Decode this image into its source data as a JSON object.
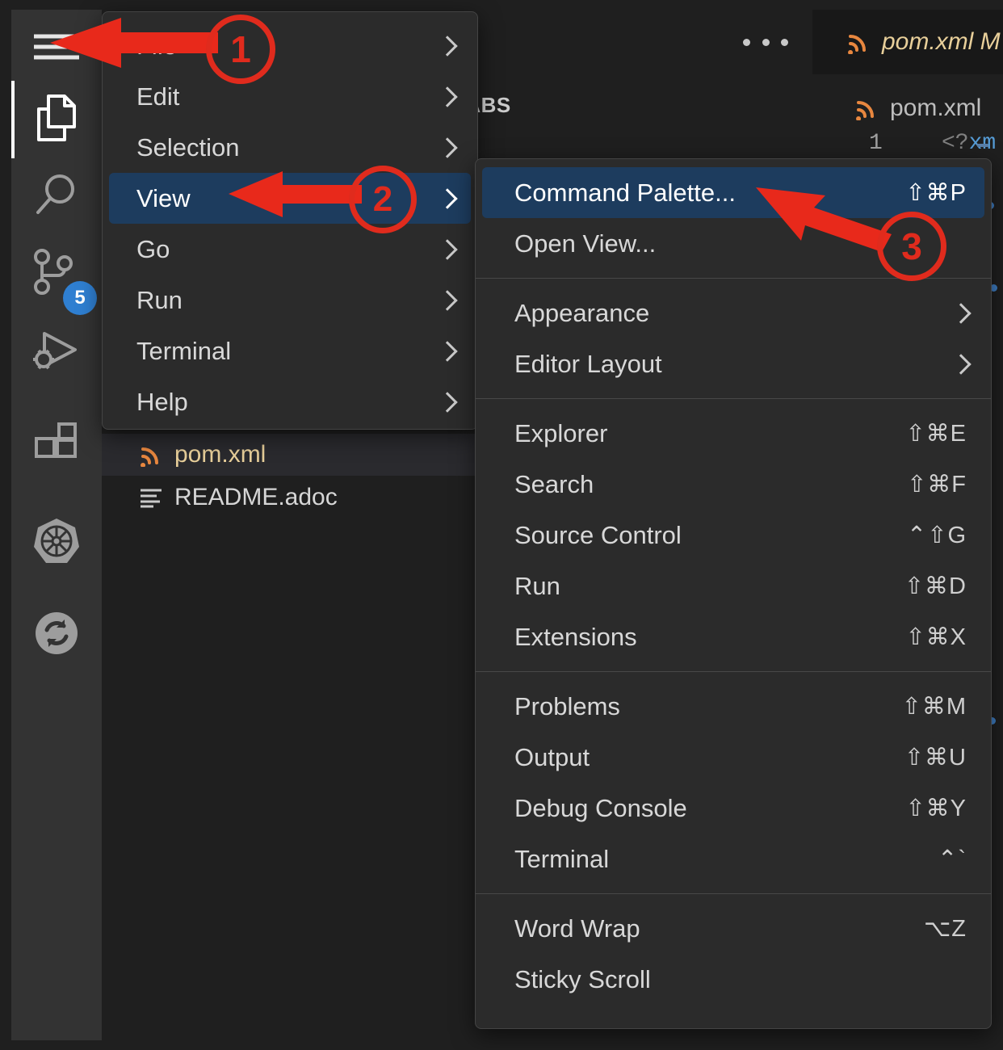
{
  "app": {
    "name": "Visual Studio Code",
    "theme_bg": "#1f1f1f",
    "accent_selected": "#1d3c5e",
    "annotation_color": "#e02b1d"
  },
  "activity_bar": {
    "items": [
      {
        "icon": "hamburger-menu-icon",
        "label": "Menu",
        "active": false,
        "badge": null
      },
      {
        "icon": "files-explorer-icon",
        "label": "Explorer",
        "active": true,
        "badge": null
      },
      {
        "icon": "search-icon",
        "label": "Search",
        "active": false,
        "badge": null
      },
      {
        "icon": "source-control-icon",
        "label": "Source Control",
        "active": false,
        "badge": "5"
      },
      {
        "icon": "run-and-debug-icon",
        "label": "Run and Debug",
        "active": false,
        "badge": null
      },
      {
        "icon": "extensions-icon",
        "label": "Extensions",
        "active": false,
        "badge": null
      },
      {
        "icon": "kubernetes-icon",
        "label": "Kubernetes",
        "active": false,
        "badge": null
      },
      {
        "icon": "sync-refresh-icon",
        "label": "Sync",
        "active": false,
        "badge": null
      }
    ]
  },
  "sidebar": {
    "title": "LABS",
    "more_actions_icon": "ellipsis-icon",
    "files": [
      {
        "name": "pom.xml",
        "icon": "xml-file-icon",
        "selected": true
      },
      {
        "name": "README.adoc",
        "icon": "asciidoc-file-icon",
        "selected": false
      }
    ]
  },
  "editor": {
    "tab": {
      "label": "pom.xml M",
      "icon": "xml-file-icon",
      "modified": true
    },
    "breadcrumb": {
      "label": "pom.xml",
      "icon": "xml-file-icon"
    },
    "line_number": "1",
    "code_fragment": "<?xm",
    "code_colors": {
      "tag_punct": "#808080",
      "tag_name": "#569cd6"
    }
  },
  "main_menu": {
    "items": [
      {
        "label": "File",
        "submenu": true,
        "selected": false
      },
      {
        "label": "Edit",
        "submenu": true,
        "selected": false
      },
      {
        "label": "Selection",
        "submenu": true,
        "selected": false
      },
      {
        "label": "View",
        "submenu": true,
        "selected": true
      },
      {
        "label": "Go",
        "submenu": true,
        "selected": false
      },
      {
        "label": "Run",
        "submenu": true,
        "selected": false
      },
      {
        "label": "Terminal",
        "submenu": true,
        "selected": false
      },
      {
        "label": "Help",
        "submenu": true,
        "selected": false
      }
    ]
  },
  "view_submenu": {
    "groups": [
      {
        "items": [
          {
            "label": "Command Palette...",
            "shortcut": "⇧⌘P",
            "submenu": false,
            "selected": true
          },
          {
            "label": "Open View...",
            "shortcut": "",
            "submenu": false,
            "selected": false
          }
        ]
      },
      {
        "items": [
          {
            "label": "Appearance",
            "shortcut": "",
            "submenu": true,
            "selected": false
          },
          {
            "label": "Editor Layout",
            "shortcut": "",
            "submenu": true,
            "selected": false
          }
        ]
      },
      {
        "items": [
          {
            "label": "Explorer",
            "shortcut": "⇧⌘E",
            "submenu": false,
            "selected": false
          },
          {
            "label": "Search",
            "shortcut": "⇧⌘F",
            "submenu": false,
            "selected": false
          },
          {
            "label": "Source Control",
            "shortcut": "⌃⇧G",
            "submenu": false,
            "selected": false
          },
          {
            "label": "Run",
            "shortcut": "⇧⌘D",
            "submenu": false,
            "selected": false
          },
          {
            "label": "Extensions",
            "shortcut": "⇧⌘X",
            "submenu": false,
            "selected": false
          }
        ]
      },
      {
        "items": [
          {
            "label": "Problems",
            "shortcut": "⇧⌘M",
            "submenu": false,
            "selected": false
          },
          {
            "label": "Output",
            "shortcut": "⇧⌘U",
            "submenu": false,
            "selected": false
          },
          {
            "label": "Debug Console",
            "shortcut": "⇧⌘Y",
            "submenu": false,
            "selected": false
          },
          {
            "label": "Terminal",
            "shortcut": "⌃`",
            "submenu": false,
            "selected": false
          }
        ]
      },
      {
        "items": [
          {
            "label": "Word Wrap",
            "shortcut": "⌥Z",
            "submenu": false,
            "selected": false
          },
          {
            "label": "Sticky Scroll",
            "shortcut": "",
            "submenu": false,
            "selected": false
          }
        ]
      }
    ]
  },
  "annotations": [
    {
      "number": "1",
      "target": "hamburger-menu-icon"
    },
    {
      "number": "2",
      "target": "main-menu-item-view"
    },
    {
      "number": "3",
      "target": "submenu-item-command-palette"
    }
  ]
}
